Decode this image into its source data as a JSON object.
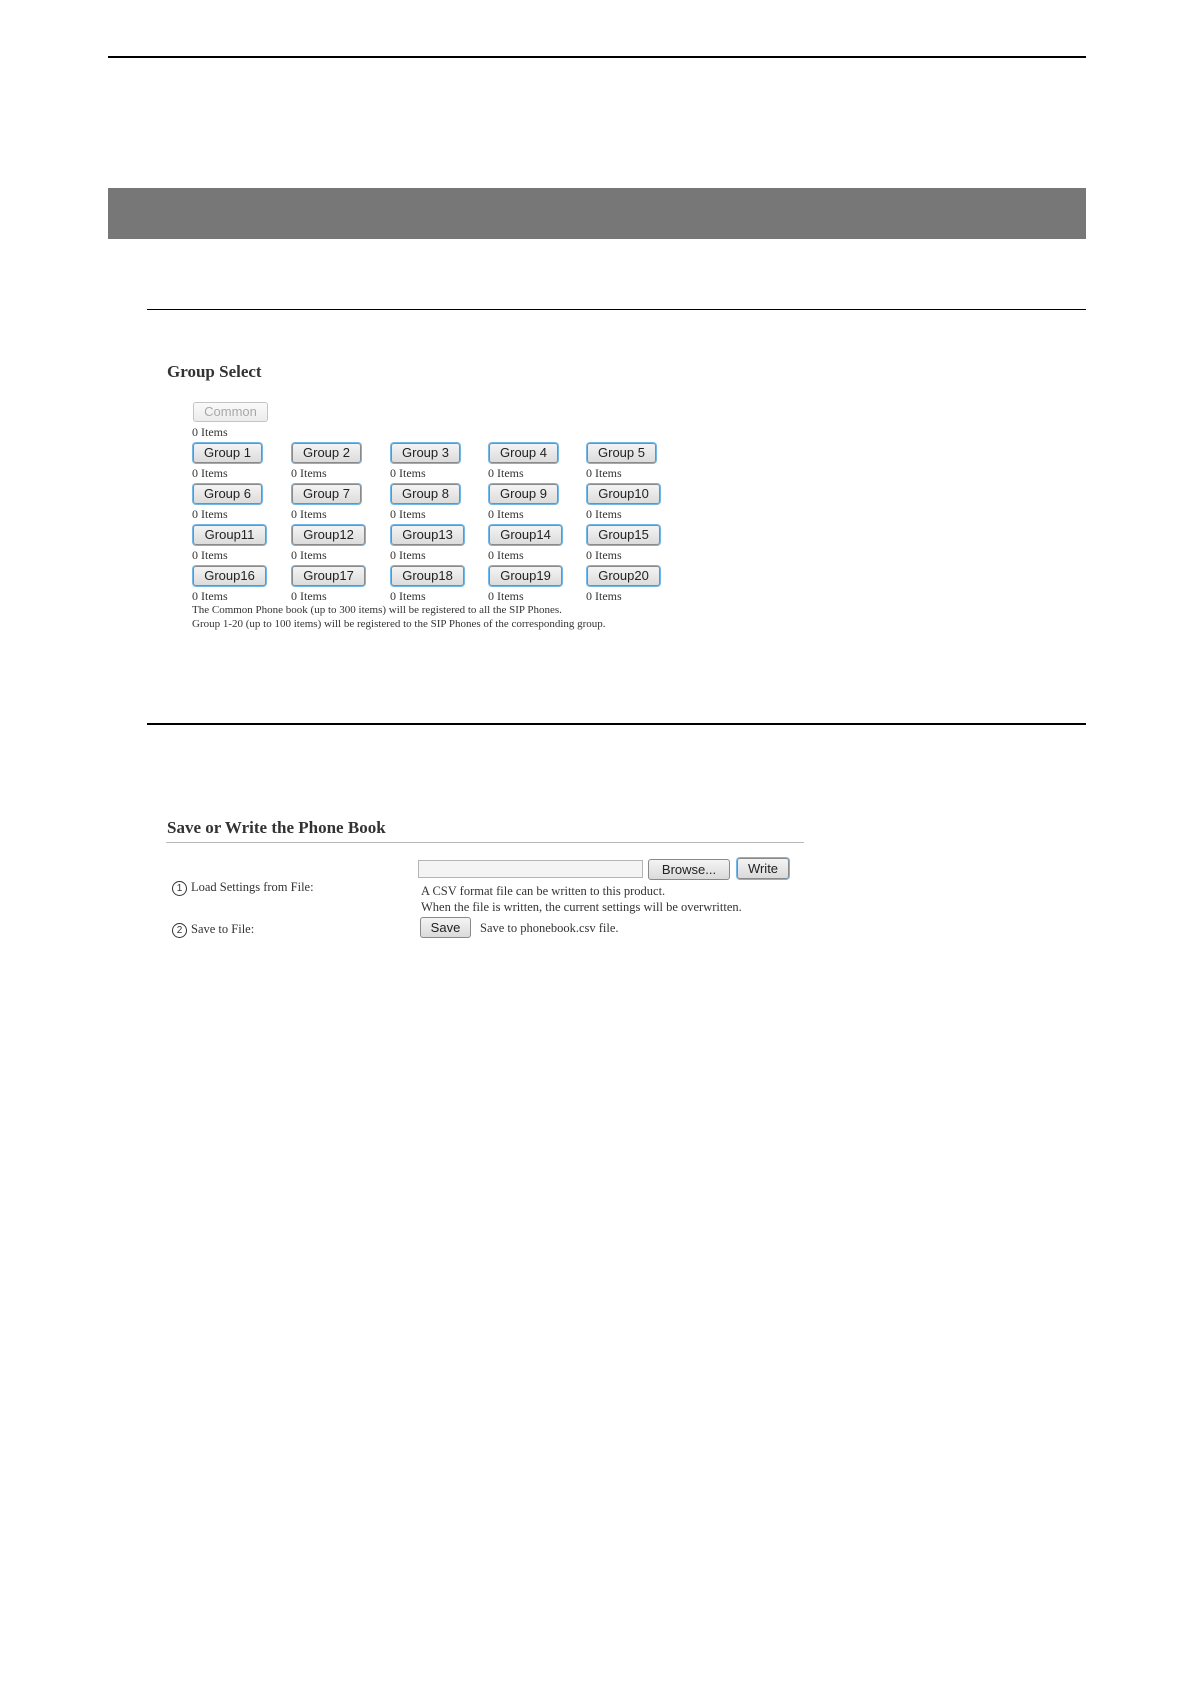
{
  "group_select": {
    "title": "Group Select",
    "common": {
      "label": "Common",
      "count": "0 Items"
    },
    "groups": [
      {
        "label": "Group 1",
        "count": "0 Items"
      },
      {
        "label": "Group 2",
        "count": "0 Items"
      },
      {
        "label": "Group 3",
        "count": "0 Items"
      },
      {
        "label": "Group 4",
        "count": "0 Items"
      },
      {
        "label": "Group 5",
        "count": "0 Items"
      },
      {
        "label": "Group 6",
        "count": "0 Items"
      },
      {
        "label": "Group 7",
        "count": "0 Items"
      },
      {
        "label": "Group 8",
        "count": "0 Items"
      },
      {
        "label": "Group 9",
        "count": "0 Items"
      },
      {
        "label": "Group10",
        "count": "0 Items"
      },
      {
        "label": "Group11",
        "count": "0 Items"
      },
      {
        "label": "Group12",
        "count": "0 Items"
      },
      {
        "label": "Group13",
        "count": "0 Items"
      },
      {
        "label": "Group14",
        "count": "0 Items"
      },
      {
        "label": "Group15",
        "count": "0 Items"
      },
      {
        "label": "Group16",
        "count": "0 Items"
      },
      {
        "label": "Group17",
        "count": "0 Items"
      },
      {
        "label": "Group18",
        "count": "0 Items"
      },
      {
        "label": "Group19",
        "count": "0 Items"
      },
      {
        "label": "Group20",
        "count": "0 Items"
      }
    ],
    "note1": "The Common Phone book (up to 300 items) will be registered to all the SIP Phones.",
    "note2": "Group 1-20 (up to 100 items) will be registered to the SIP Phones of the corresponding group."
  },
  "phone_book": {
    "title": "Save or Write the Phone Book",
    "load": {
      "number": "1",
      "label": "Load Settings from File:",
      "browse_label": "Browse...",
      "write_label": "Write",
      "desc1": "A CSV format file can be written to this product.",
      "desc2": "When the file is written, the current settings will be overwritten."
    },
    "save": {
      "number": "2",
      "label": "Save to File:",
      "save_label": "Save",
      "desc": "Save to phonebook.csv file."
    }
  }
}
